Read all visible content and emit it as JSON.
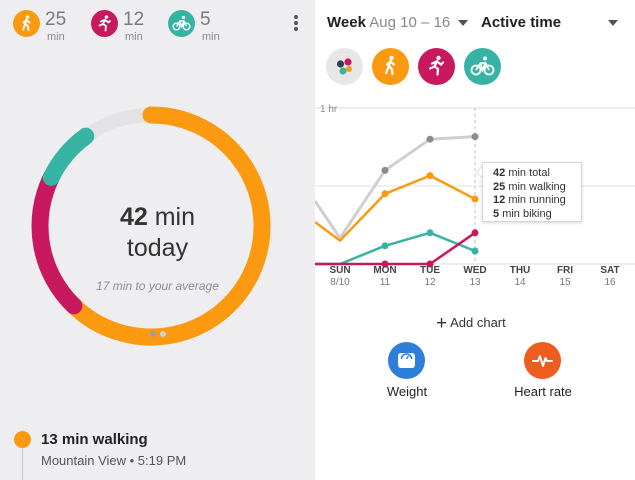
{
  "colors": {
    "walking": "#fb9a10",
    "running": "#c8185e",
    "biking": "#37b3a4",
    "total": "#cfcfcf",
    "weight": "#2f7ed8",
    "heart": "#ef5d1e",
    "track": "#e3e3e5"
  },
  "stats": [
    {
      "icon": "walking-icon",
      "value": "25",
      "unit": "min"
    },
    {
      "icon": "running-icon",
      "value": "12",
      "unit": "min"
    },
    {
      "icon": "biking-icon",
      "value": "5",
      "unit": "min"
    }
  ],
  "overflow_menu_icon": "more-vert-icon",
  "ring": {
    "total_value": "42",
    "total_unit": "min",
    "label": "today",
    "comparison": "17 min to your average",
    "segments_minutes": {
      "walking": 25,
      "running": 12,
      "biking": 5
    },
    "pager": {
      "count": 2,
      "active": 1
    }
  },
  "activity": {
    "title": "13 min walking",
    "subtitle": "Mountain View • 5:19 PM"
  },
  "header": {
    "range_label": "Week",
    "range_value": "Aug 10 – 16",
    "metric_label": "Active time"
  },
  "filters": [
    {
      "name": "all-activities-filter",
      "icon": "all-activities-icon"
    },
    {
      "name": "walking-filter",
      "icon": "walking-icon"
    },
    {
      "name": "running-filter",
      "icon": "running-icon"
    },
    {
      "name": "biking-filter",
      "icon": "biking-icon"
    }
  ],
  "chart_data": {
    "type": "line",
    "y_gridline_label": "1 hr",
    "ylim": [
      0,
      60
    ],
    "categories": [
      {
        "day": "SUN",
        "date": "8/10"
      },
      {
        "day": "MON",
        "date": "11"
      },
      {
        "day": "TUE",
        "date": "12"
      },
      {
        "day": "WED",
        "date": "13"
      },
      {
        "day": "THU",
        "date": "14"
      },
      {
        "day": "FRI",
        "date": "15"
      },
      {
        "day": "SAT",
        "date": "16"
      }
    ],
    "series": [
      {
        "key": "total",
        "values": [
          10,
          36,
          48,
          49
        ]
      },
      {
        "key": "walking",
        "values": [
          9,
          27,
          34,
          25
        ]
      },
      {
        "key": "biking",
        "values": [
          0,
          7,
          12,
          5
        ]
      },
      {
        "key": "running",
        "values": [
          0,
          0,
          0,
          12
        ]
      }
    ],
    "selected_index": 3
  },
  "tooltip": {
    "total_value": "42",
    "total_label": "min total",
    "walking_value": "25",
    "walking_label": "min walking",
    "running_value": "12",
    "running_label": "min running",
    "biking_value": "5",
    "biking_label": "min biking"
  },
  "add_chart_label": "Add chart",
  "shortcuts": [
    {
      "label": "Weight",
      "icon": "scale-icon"
    },
    {
      "label": "Heart rate",
      "icon": "heart-rate-icon"
    }
  ]
}
